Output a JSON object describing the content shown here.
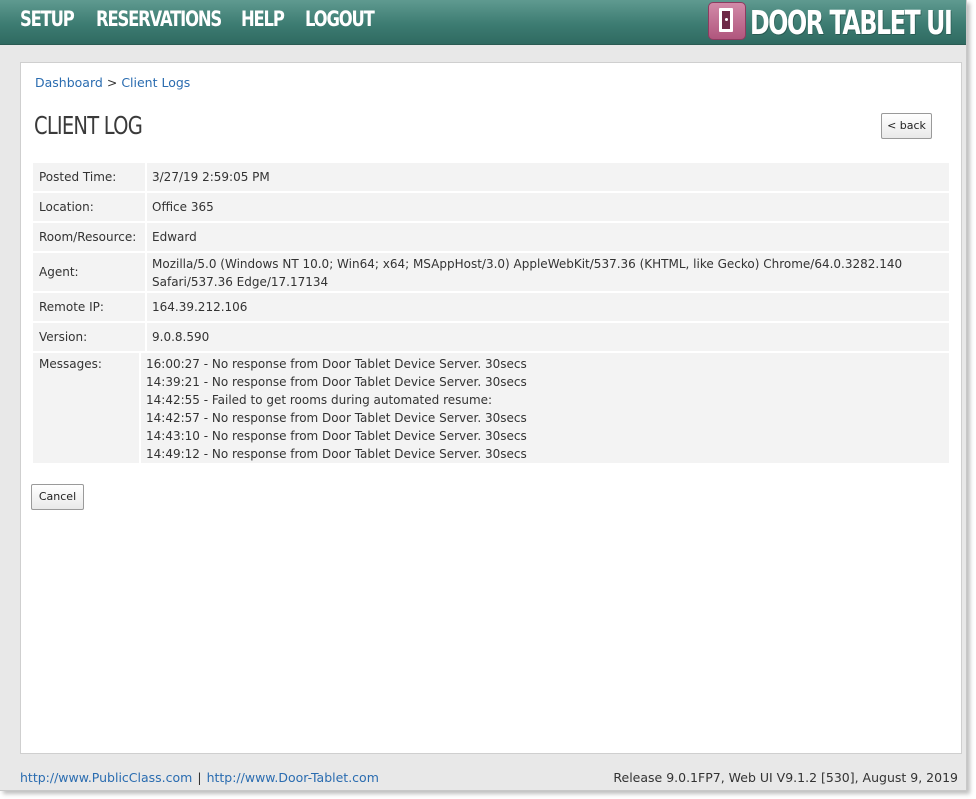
{
  "nav": {
    "items": [
      {
        "label": "SETUP"
      },
      {
        "label": "RESERVATIONS"
      },
      {
        "label": "HELP"
      },
      {
        "label": "LOGOUT"
      }
    ],
    "logo_text": "DOOR TABLET UI",
    "logo_icon": "door-icon",
    "colors": {
      "bar": "#3d7c72",
      "logo_icon": "#b0567d"
    }
  },
  "breadcrumb": {
    "items": [
      {
        "label": "Dashboard"
      },
      {
        "label": "Client Logs"
      }
    ],
    "separator": ">"
  },
  "page": {
    "title": "CLIENT LOG",
    "back_label": "< back",
    "cancel_label": "Cancel"
  },
  "details": {
    "posted_time": {
      "label": "Posted Time:",
      "value": "3/27/19 2:59:05 PM"
    },
    "location": {
      "label": "Location:",
      "value": "Office 365"
    },
    "room": {
      "label": "Room/Resource:",
      "value": "Edward"
    },
    "agent": {
      "label": "Agent:",
      "lines": [
        "Mozilla/5.0 (Windows NT 10.0; Win64; x64; MSAppHost/3.0) AppleWebKit/537.36 (KHTML, like Gecko) Chrome/64.0.3282.140",
        "Safari/537.36 Edge/17.17134"
      ]
    },
    "remote_ip": {
      "label": "Remote IP:",
      "value": "164.39.212.106"
    },
    "version": {
      "label": "Version:",
      "value": "9.0.8.590"
    },
    "messages": {
      "label": "Messages:",
      "lines": [
        "16:00:27 - No response from Door Tablet Device Server. 30secs",
        "14:39:21 - No response from Door Tablet Device Server. 30secs",
        "14:42:55 - Failed to get rooms during automated resume:",
        "14:42:57 - No response from Door Tablet Device Server. 30secs",
        "14:43:10 - No response from Door Tablet Device Server. 30secs",
        "14:49:12 - No response from Door Tablet Device Server. 30secs"
      ]
    }
  },
  "footer": {
    "link1": "http://www.PublicClass.com",
    "separator": "|",
    "link2": "http://www.Door-Tablet.com",
    "release": "Release 9.0.1FP7, Web UI V9.1.2 [530], August 9, 2019"
  }
}
